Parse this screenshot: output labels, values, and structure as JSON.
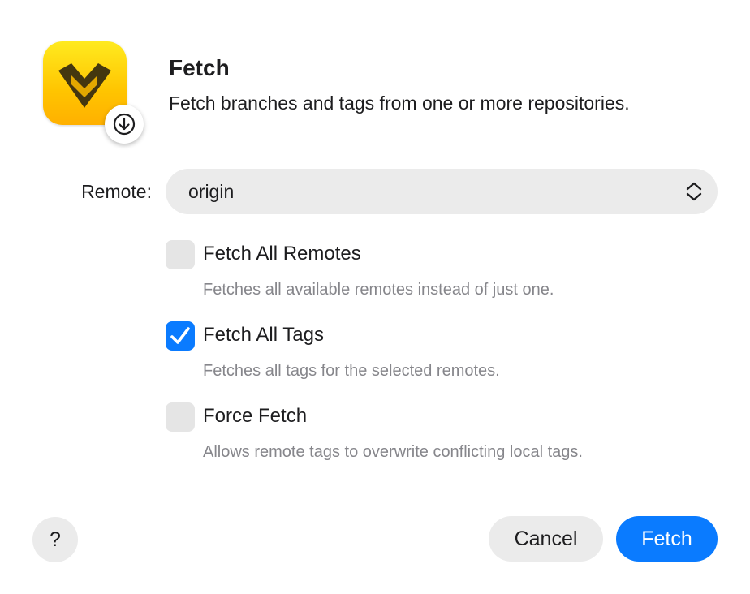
{
  "header": {
    "title": "Fetch",
    "subtitle": "Fetch branches and tags from one or more repositories.",
    "app_icon": "app-logo-icon",
    "badge_icon": "download-arrow-icon"
  },
  "remote": {
    "label": "Remote:",
    "selected": "origin"
  },
  "options": [
    {
      "label": "Fetch All Remotes",
      "description": "Fetches all available remotes instead of just one.",
      "checked": false
    },
    {
      "label": "Fetch All Tags",
      "description": "Fetches all tags for the selected remotes.",
      "checked": true
    },
    {
      "label": "Force Fetch",
      "description": "Allows remote tags to overwrite conflicting local tags.",
      "checked": false
    }
  ],
  "footer": {
    "help_label": "?",
    "cancel_label": "Cancel",
    "confirm_label": "Fetch"
  },
  "colors": {
    "accent": "#0a7bff",
    "icon_yellow": "#ffd000",
    "control_background": "#ebebeb",
    "secondary_text": "#86868b"
  }
}
